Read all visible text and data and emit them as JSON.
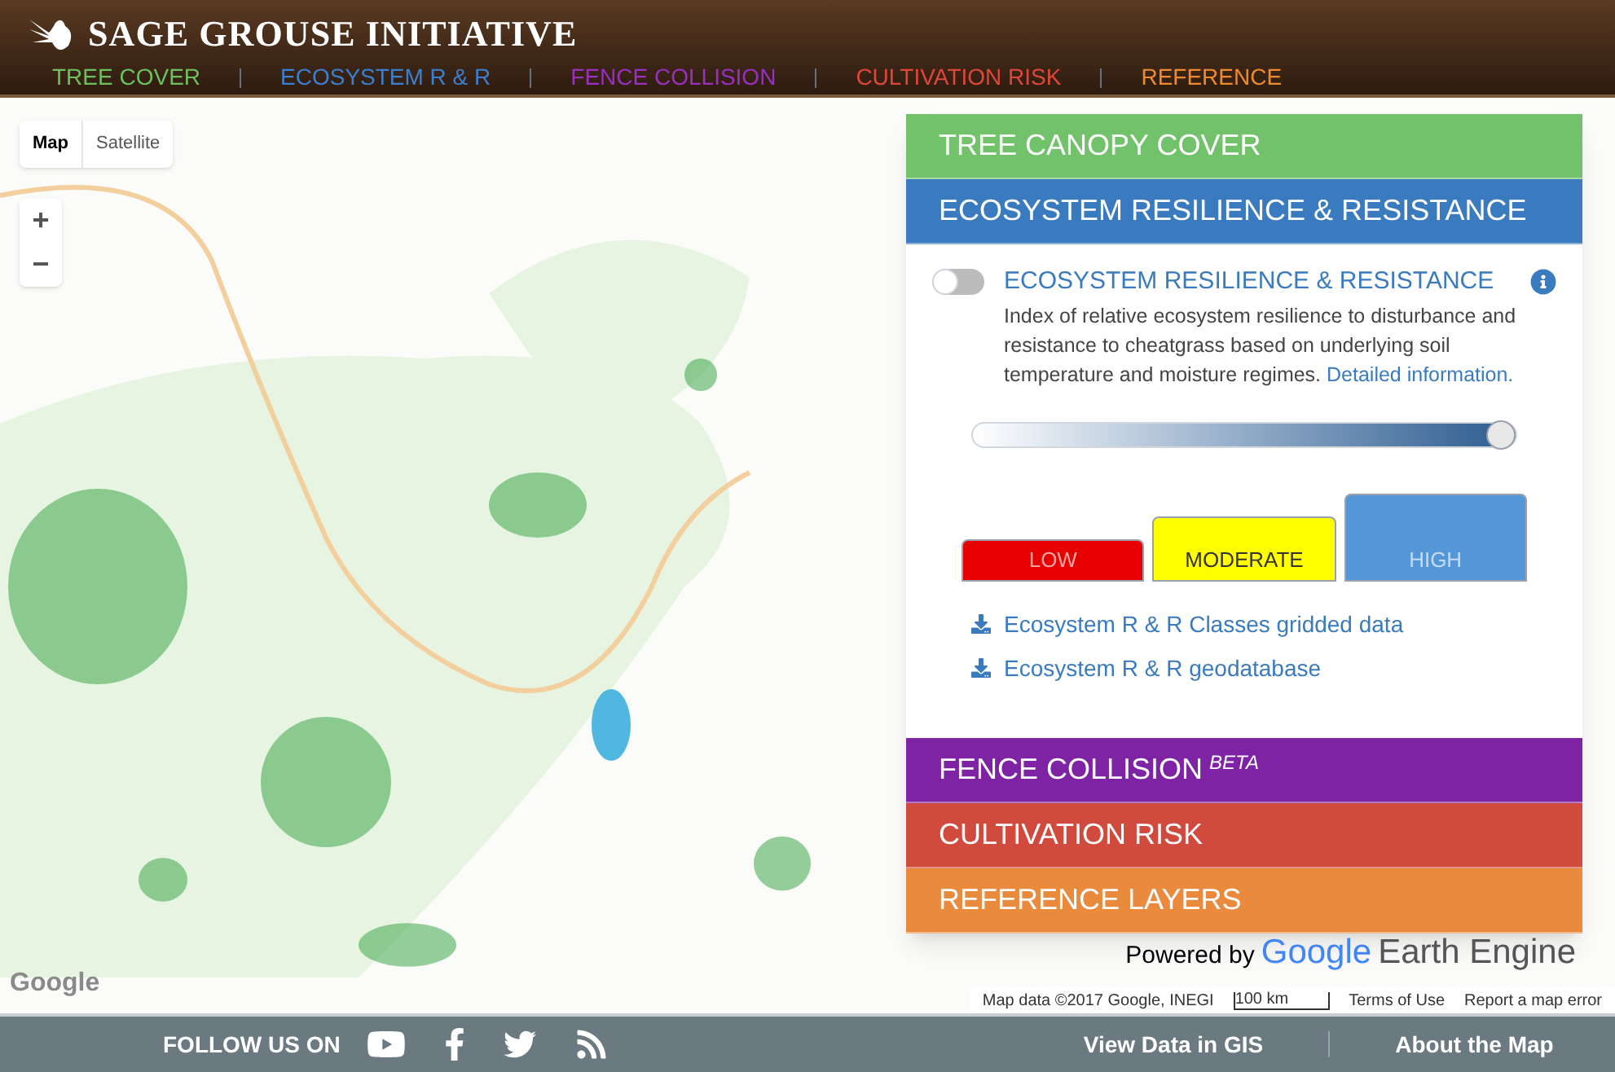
{
  "header": {
    "title": "SAGE GROUSE INITIATIVE",
    "nav": [
      {
        "label": "TREE COVER",
        "color": "#6cc05e"
      },
      {
        "label": "ECOSYSTEM R & R",
        "color": "#3b7fd0"
      },
      {
        "label": "FENCE COLLISION",
        "color": "#9a2fc2"
      },
      {
        "label": "CULTIVATION RISK",
        "color": "#e0463a"
      },
      {
        "label": "REFERENCE",
        "color": "#f08b2d"
      }
    ]
  },
  "map": {
    "type_buttons": [
      {
        "label": "Map",
        "selected": true
      },
      {
        "label": "Satellite",
        "selected": false
      }
    ],
    "zoom_buttons": [
      "+",
      "−"
    ],
    "google_mark": "Google",
    "powered_by": {
      "prefix": "Powered by",
      "brand": "Google",
      "product": "Earth Engine"
    },
    "attribution": {
      "data": "Map data ©2017 Google, INEGI",
      "scale": "100 km",
      "terms": "Terms of Use",
      "report": "Report a map error"
    }
  },
  "panel": {
    "sections": [
      {
        "title": "TREE CANOPY COVER",
        "color": "#72c16b"
      },
      {
        "title": "ECOSYSTEM RESILIENCE & RESISTANCE",
        "color": "#3a7bbf",
        "layer": {
          "title": "ECOSYSTEM RESILIENCE & RESISTANCE",
          "on": false,
          "description": "Index of relative ecosystem resilience to disturbance and resistance to cheatgrass based on underlying soil temperature and moisture regimes.",
          "link": "Detailed information.",
          "opacity": {
            "level": 1
          },
          "classes": [
            {
              "label": "LOW",
              "color": "#e60000"
            },
            {
              "label": "MODERATE",
              "color": "#ffff00"
            },
            {
              "label": "HIGH",
              "color": "#5597d6"
            }
          ],
          "downloads": [
            "Ecosystem R & R Classes gridded data",
            "Ecosystem R & R geodatabase"
          ]
        }
      },
      {
        "title": "FENCE COLLISION",
        "badge": "BETA",
        "color": "#7e23a3"
      },
      {
        "title": "CULTIVATION RISK",
        "color": "#d04a3e"
      },
      {
        "title": "REFERENCE LAYERS",
        "color": "#e98a3d"
      }
    ]
  },
  "footer": {
    "follow_label": "FOLLOW US ON",
    "links": [
      "View Data in GIS",
      "About the Map"
    ]
  }
}
